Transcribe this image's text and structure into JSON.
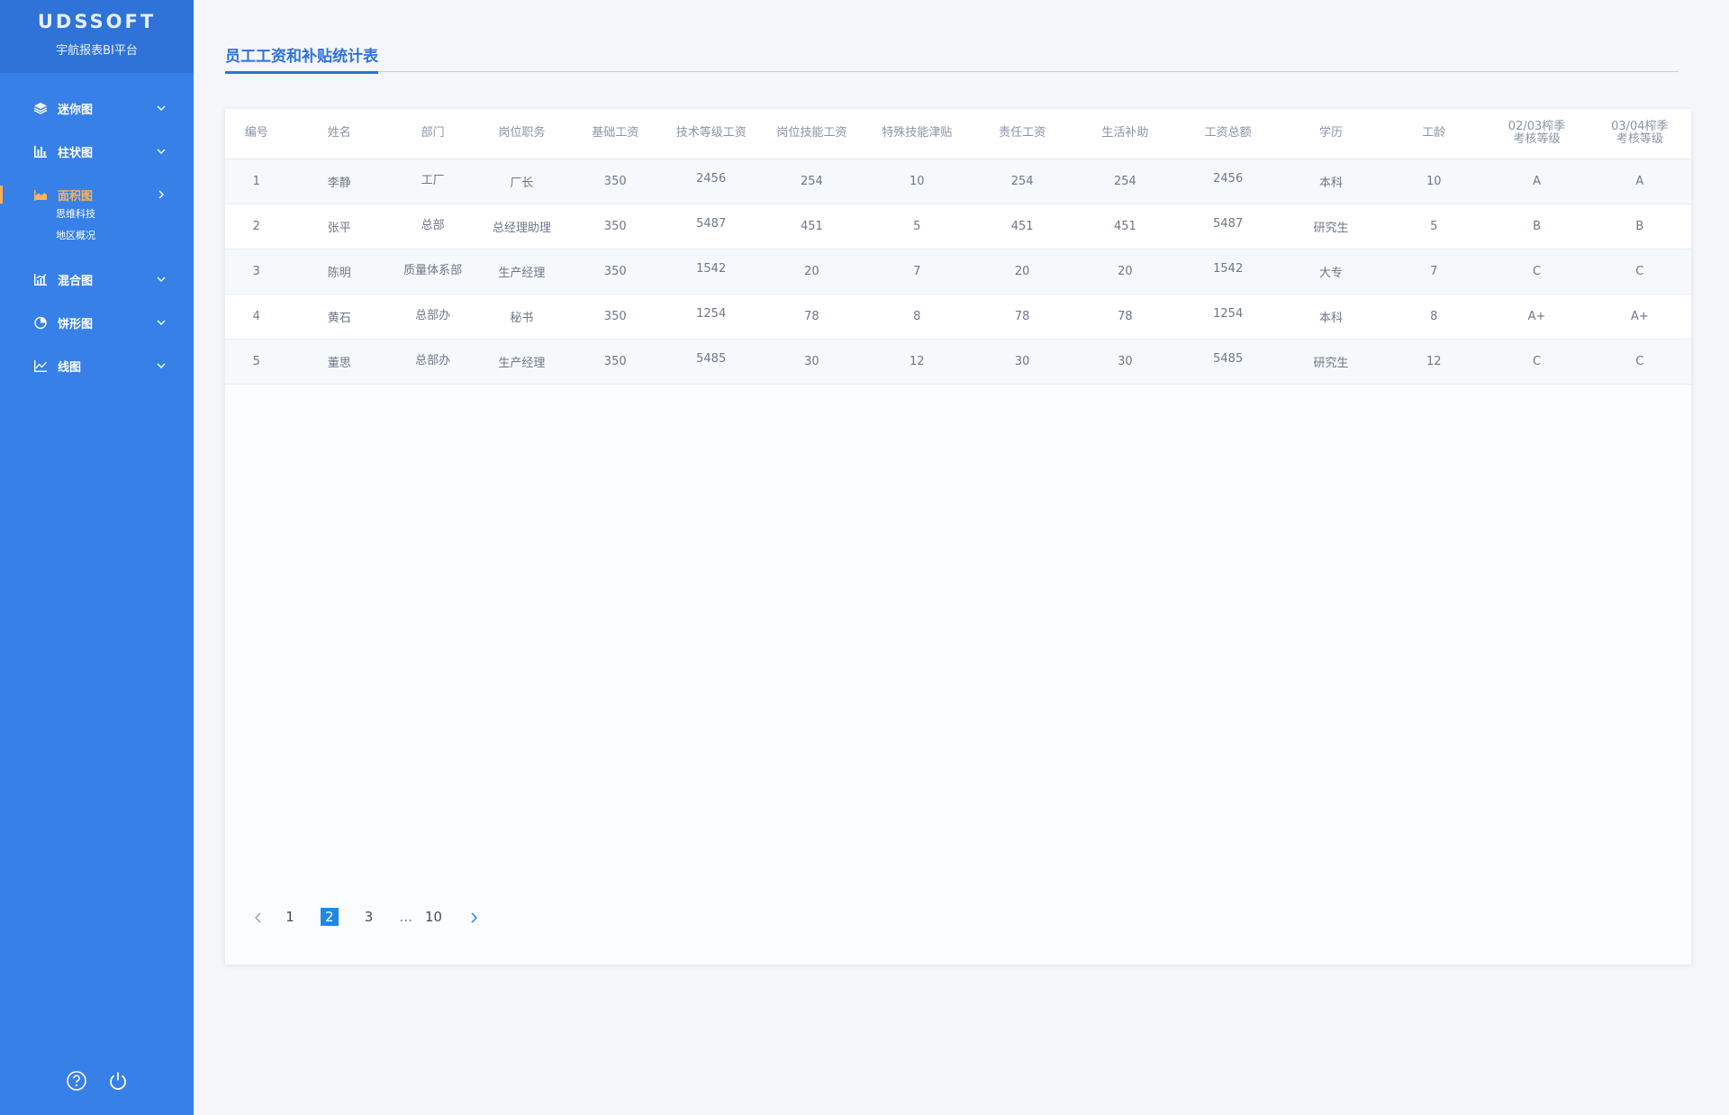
{
  "brand": {
    "logo": "UDSSOFT",
    "subtitle": "宇航报表BI平台"
  },
  "sidebar": {
    "items": [
      {
        "label": "迷你图",
        "icon": "layers-icon"
      },
      {
        "label": "柱状图",
        "icon": "bar-chart-icon"
      },
      {
        "label": "面积图",
        "icon": "area-chart-icon",
        "active": true,
        "children": [
          "思维科技",
          "地区概况"
        ]
      },
      {
        "label": "混合图",
        "icon": "mixed-chart-icon"
      },
      {
        "label": "饼形图",
        "icon": "pie-chart-icon"
      },
      {
        "label": "线图",
        "icon": "line-chart-icon"
      }
    ],
    "bottom_icons": [
      "help-icon",
      "power-icon"
    ]
  },
  "page": {
    "title": "员工工资和补贴统计表"
  },
  "table": {
    "headers": [
      "编号",
      "姓名",
      "部门",
      "岗位职务",
      "基础工资",
      "技术等级工资",
      "岗位技能工资",
      "特殊技能津贴",
      "责任工资",
      "生活补助",
      "工资总额",
      "学历",
      "工龄",
      "02/03榨季\n考核等级",
      "03/04榨季\n考核等级"
    ],
    "rows": [
      [
        "1",
        "李静",
        "工厂",
        "厂长",
        "350",
        "2456",
        "254",
        "10",
        "254",
        "254",
        "2456",
        "本科",
        "10",
        "A",
        "A"
      ],
      [
        "2",
        "张平",
        "总部",
        "总经理助理",
        "350",
        "5487",
        "451",
        "5",
        "451",
        "451",
        "5487",
        "研究生",
        "5",
        "B",
        "B"
      ],
      [
        "3",
        "陈明",
        "质量体系部",
        "生产经理",
        "350",
        "1542",
        "20",
        "7",
        "20",
        "20",
        "1542",
        "大专",
        "7",
        "C",
        "C"
      ],
      [
        "4",
        "黄石",
        "总部办",
        "秘书",
        "350",
        "1254",
        "78",
        "8",
        "78",
        "78",
        "1254",
        "本科",
        "8",
        "A+",
        "A+"
      ],
      [
        "5",
        "董思",
        "总部办",
        "生产经理",
        "350",
        "5485",
        "30",
        "12",
        "30",
        "30",
        "5485",
        "研究生",
        "12",
        "C",
        "C"
      ]
    ]
  },
  "pagination": {
    "pages": [
      "1",
      "2",
      "3",
      "...",
      "10"
    ],
    "current": "2"
  },
  "colors": {
    "sidebar": "#3680e8",
    "brand_bg": "#2f72d8",
    "active": "#ffb259",
    "accent": "#1e88e5"
  }
}
